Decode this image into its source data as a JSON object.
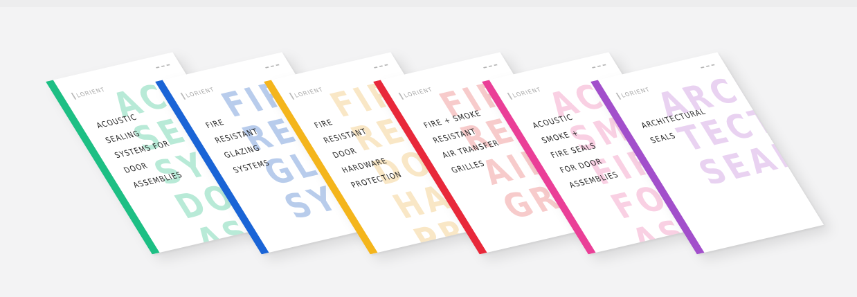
{
  "brand": "LORIENT",
  "brochures": [
    {
      "title": "ACOUSTIC\nSEALING\nSYSTEMS FOR\nDOOR\nASSEMBLIES",
      "watermark": "ACO\nSEAL\nSYS\nDOO\nASS",
      "color": "#1dbf84",
      "watermark_color": "#7fd9b6"
    },
    {
      "title": "FIRE\nRESISTANT\nGLAZING\nSYSTEMS",
      "watermark": "FIRE\nRESI\nGLA\nSYS",
      "color": "#1a64d6",
      "watermark_color": "#7fa3dc"
    },
    {
      "title": "FIRE\nRESISTANT\nDOOR\nHARDWARE\nPROTECTION",
      "watermark": "FIRE\nRESI\nDOO\nHAR\nPRO",
      "color": "#f4b51c",
      "watermark_color": "#f5d497"
    },
    {
      "title": "FIRE + SMOKE\nRESISTANT\nAIR TRANSFER\nGRILLES",
      "watermark": "FIRE\nRES\nAIR\nGRI",
      "color": "#e8283a",
      "watermark_color": "#f0a0a0"
    },
    {
      "title": "ACOUSTIC\nSMOKE +\nFIRE SEALS\nFOR DOOR\nASSEMBLIES",
      "watermark": "ACO\nSMO\nFIRE\nFOR\nASS",
      "color": "#ea3f97",
      "watermark_color": "#f4a9cc"
    },
    {
      "title": "ARCHITECTURAL\nSEALS",
      "watermark": "ARCHI-\nTECTU\nSEALS",
      "color": "#a24fcb",
      "watermark_color": "#d7aee6"
    }
  ]
}
